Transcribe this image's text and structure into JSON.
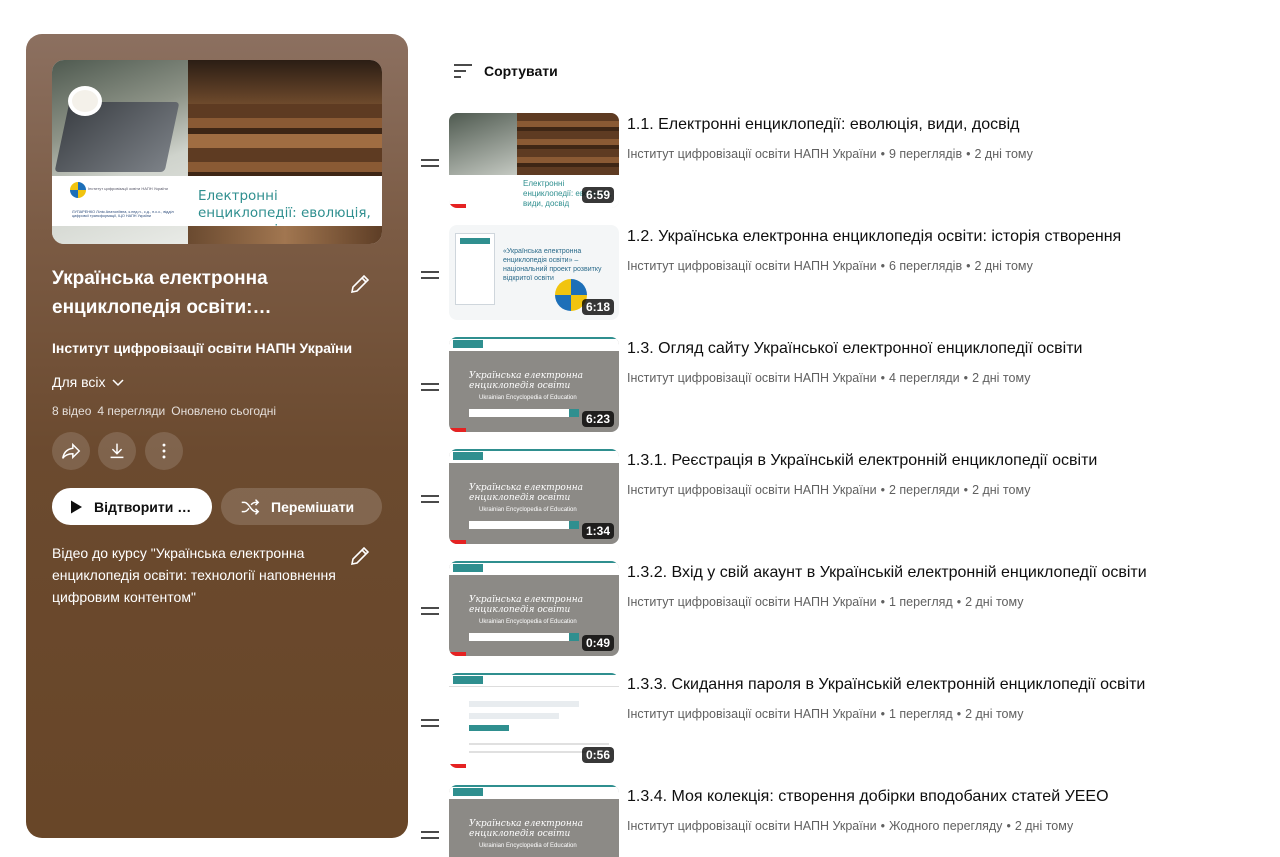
{
  "playlist": {
    "title": "Українська електронна енциклопедія освіти:…",
    "channel": "Інститут цифровізації освіти НАПН України",
    "visibility": "Для всіх",
    "stats": [
      "8 відео",
      "4 перегляди",
      "Оновлено сьогодні"
    ],
    "play_label": "Відтворити …",
    "shuffle_label": "Перемішати",
    "description": "Відео до курсу \"Українська електронна енциклопедія освіти: технології наповнення цифровим контентом\"",
    "hero": {
      "title": "Електронні енциклопедії: еволюція, види, досвід",
      "org": "Інститут цифровізації освіти НАПН України",
      "author": "ЛУПАРЕНКО Лілія Анатоліївна, к.пед.н., с.д., н.с.с., відділ цифрової трансформації, ІЦО НАПН України"
    }
  },
  "sort_label": "Сортувати",
  "thumb_text": {
    "books": "Електронні енциклопедії: еволюція, види, досвід",
    "slide": "«Українська електронна енциклопедія освіти» – національний проект розвитку відкритої освіти",
    "site_title": "Українська електронна енциклопедія освіти",
    "site_sub": "Ukrainian Encyclopedia of Education"
  },
  "videos": [
    {
      "title": "1.1. Електронні енциклопедії: еволюція, види, досвід",
      "channel": "Інститут цифровізації освіти НАПН України",
      "views": "9 переглядів",
      "age": "2 дні тому",
      "duration": "6:59",
      "progress": 0.1
    },
    {
      "title": "1.2. Українська електронна енциклопедія освіти: історія створення",
      "channel": "Інститут цифровізації освіти НАПН України",
      "views": "6 переглядів",
      "age": "2 дні тому",
      "duration": "6:18",
      "progress": 0
    },
    {
      "title": "1.3. Огляд сайту Української електронної енциклопедії освіти",
      "channel": "Інститут цифровізації освіти НАПН України",
      "views": "4 перегляди",
      "age": "2 дні тому",
      "duration": "6:23",
      "progress": 0.1
    },
    {
      "title": "1.3.1. Реєстрація в Українській електронній енциклопедії освіти",
      "channel": "Інститут цифровізації освіти НАПН України",
      "views": "2 перегляди",
      "age": "2 дні тому",
      "duration": "1:34",
      "progress": 0.1
    },
    {
      "title": "1.3.2. Вхід у свій акаунт в Українській електронній енциклопедії освіти",
      "channel": "Інститут цифровізації освіти НАПН України",
      "views": "1 перегляд",
      "age": "2 дні тому",
      "duration": "0:49",
      "progress": 0.1
    },
    {
      "title": "1.3.3. Скидання пароля в Українській електронній енциклопедії освіти",
      "channel": "Інститут цифровізації освіти НАПН України",
      "views": "1 перегляд",
      "age": "2 дні тому",
      "duration": "0:56",
      "progress": 0.1
    },
    {
      "title": "1.3.4. Моя колекція: створення добірки вподобаних статей УЕЕО",
      "channel": "Інститут цифровізації освіти НАПН України",
      "views": "Жодного перегляду",
      "age": "2 дні тому",
      "duration": "",
      "progress": 0
    }
  ],
  "colors": {
    "panel": "#6b4a2f",
    "progress": "#e52222",
    "accent": "#2f8f8f"
  }
}
